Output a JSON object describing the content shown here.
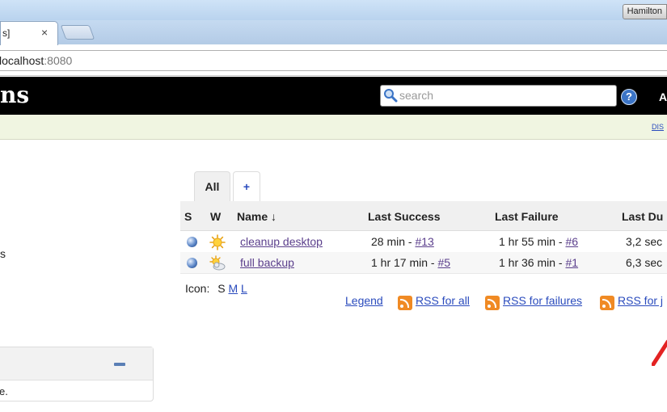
{
  "browser": {
    "user": "Hamilton",
    "tab_title": "s]",
    "tab_close": "×",
    "url_host": "localhost",
    "url_port": ":8080"
  },
  "header": {
    "logo_text": "ns",
    "search_placeholder": "search",
    "help": "?",
    "right_text": "A"
  },
  "subbar": {
    "link_text": "DIS"
  },
  "sidebar": {
    "item_text": "s",
    "box_text": "e."
  },
  "view_tabs": [
    {
      "label": "All"
    },
    {
      "label": "+"
    }
  ],
  "table": {
    "columns": [
      "S",
      "W",
      "Name ↓",
      "Last Success",
      "Last Failure",
      "Last Du"
    ],
    "rows": [
      {
        "weather_icon": "sun-icon",
        "name": "cleanup desktop",
        "last_success_time": "28 min - ",
        "last_success_build": "#13",
        "last_failure_time": "1 hr 55 min - ",
        "last_failure_build": "#6",
        "last_duration": "3,2 sec"
      },
      {
        "weather_icon": "partly-cloudy-icon",
        "name": "full backup",
        "last_success_time": "1 hr 17 min - ",
        "last_success_build": "#5",
        "last_failure_time": "1 hr 36 min - ",
        "last_failure_build": "#1",
        "last_duration": "6,3 sec"
      }
    ]
  },
  "icon_size": {
    "label": "Icon:",
    "s": "S",
    "m": "M",
    "l": "L"
  },
  "footer": {
    "legend": "Legend",
    "rss_all": "RSS for all",
    "rss_failures": "RSS for failures",
    "rss_just": "RSS for j"
  },
  "colors": {
    "header_bg": "#000000",
    "subbar_bg": "#f0f5e1",
    "link": "#2a4bbd",
    "rss": "#f08a24"
  }
}
